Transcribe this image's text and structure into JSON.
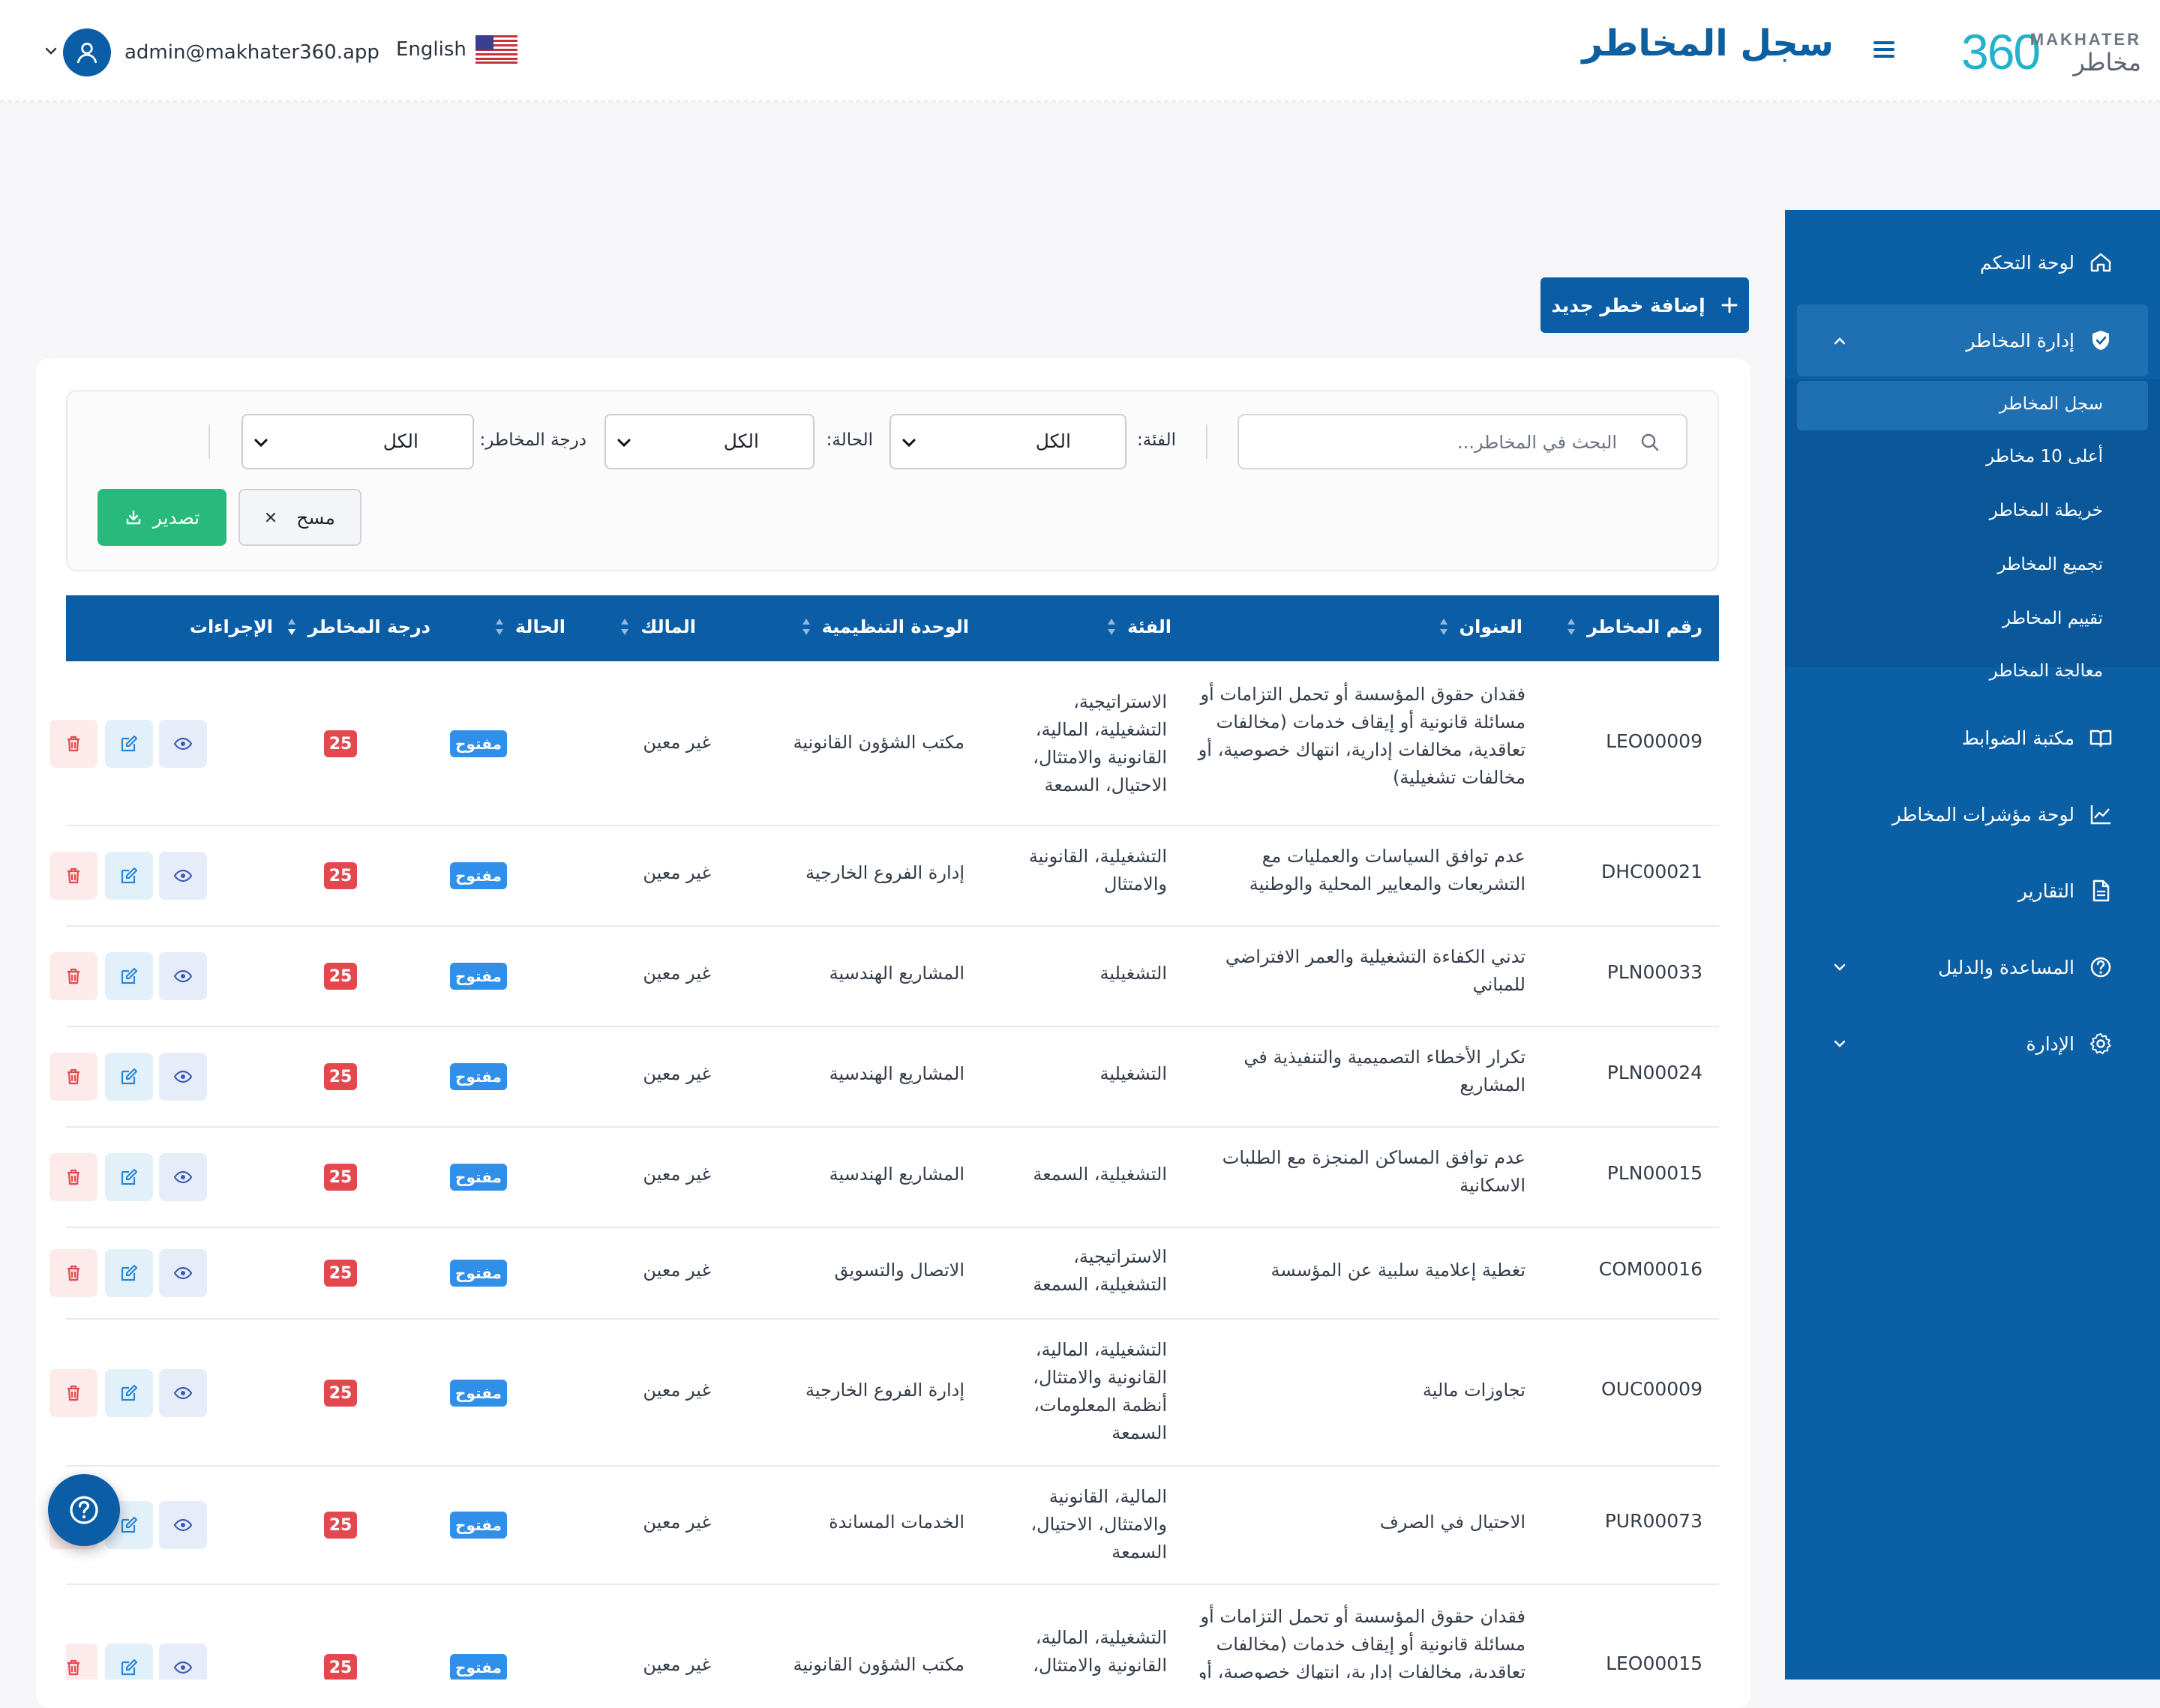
{
  "header": {
    "logo_num": "360",
    "logo_en": "MAKHATER",
    "logo_ar": "مخاطر",
    "title": "سجل المخاطر",
    "language": "English",
    "user_email": "admin@makhater360.app"
  },
  "sidebar": {
    "items": [
      {
        "label": "لوحة التحكم",
        "icon": "home-icon"
      },
      {
        "label": "إدارة المخاطر",
        "icon": "shield-icon"
      },
      {
        "label": "مكتبة الضوابط",
        "icon": "book-icon"
      },
      {
        "label": "لوحة مؤشرات المخاطر",
        "icon": "chart-line-icon"
      },
      {
        "label": "التقارير",
        "icon": "document-icon"
      },
      {
        "label": "المساعدة والدليل",
        "icon": "help-circle-icon"
      },
      {
        "label": "الإدارة",
        "icon": "gear-icon"
      }
    ],
    "submenu": [
      {
        "label": "سجل المخاطر"
      },
      {
        "label": "أعلى 10 مخاطر"
      },
      {
        "label": "خريطة المخاطر"
      },
      {
        "label": "تجميع المخاطر"
      },
      {
        "label": "تقييم المخاطر"
      },
      {
        "label": "معالجة المخاطر"
      }
    ]
  },
  "toolbar": {
    "add_label": "إضافة خطر جديد"
  },
  "filters": {
    "search_placeholder": "البحث في المخاطر...",
    "category_label": "الفئة:",
    "category_value": "الكل",
    "status_label": "الحالة:",
    "status_value": "الكل",
    "level_label": "درجة المخاطر:",
    "level_value": "الكل",
    "clear_label": "مسح",
    "export_label": "تصدير"
  },
  "table": {
    "columns": [
      "رقم المخاطر",
      "العنوان",
      "الفئة",
      "الوحدة التنظيمية",
      "المالك",
      "الحالة",
      "درجة المخاطر",
      "الإجراءات"
    ],
    "rows": [
      {
        "id": "LEO00009",
        "title": "فقدان حقوق المؤسسة أو تحمل التزامات أو مسائلة قانونية أو إيقاف خدمات (مخالفات تعاقدية، مخالفات إدارية، انتهاك خصوصية، أو مخالفات تشغيلية)",
        "category": "الاستراتيجية، التشغيلية، المالية، القانونية والامتثال، الاحتيال، السمعة",
        "unit": "مكتب الشؤون القانونية",
        "owner": "غير معين",
        "status": "مفتوح",
        "score": "25"
      },
      {
        "id": "DHC00021",
        "title": "عدم توافق السياسات والعمليات مع التشريعات والمعايير المحلية والوطنية",
        "category": "التشغيلية، القانونية والامتثال",
        "unit": "إدارة الفروع الخارجية",
        "owner": "غير معين",
        "status": "مفتوح",
        "score": "25"
      },
      {
        "id": "PLN00033",
        "title": "تدني الكفاءة التشغيلية والعمر الافتراضي للمباني",
        "category": "التشغيلية",
        "unit": "المشاريع الهندسية",
        "owner": "غير معين",
        "status": "مفتوح",
        "score": "25"
      },
      {
        "id": "PLN00024",
        "title": "تكرار الأخطاء التصميمية والتنفيذية في المشاريع",
        "category": "التشغيلية",
        "unit": "المشاريع الهندسية",
        "owner": "غير معين",
        "status": "مفتوح",
        "score": "25"
      },
      {
        "id": "PLN00015",
        "title": "عدم توافق المساكن المنجزة مع الطلبات الاسكانية",
        "category": "التشغيلية، السمعة",
        "unit": "المشاريع الهندسية",
        "owner": "غير معين",
        "status": "مفتوح",
        "score": "25"
      },
      {
        "id": "COM00016",
        "title": "تغطية إعلامية سلبية عن المؤسسة",
        "category": "الاستراتيجية، التشغيلية، السمعة",
        "unit": "الاتصال والتسويق",
        "owner": "غير معين",
        "status": "مفتوح",
        "score": "25"
      },
      {
        "id": "OUC00009",
        "title": "تجاوزات مالية",
        "category": "التشغيلية، المالية، القانونية والامتثال، أنظمة المعلومات، السمعة",
        "unit": "إدارة الفروع الخارجية",
        "owner": "غير معين",
        "status": "مفتوح",
        "score": "25"
      },
      {
        "id": "PUR00073",
        "title": "الاحتيال في الصرف",
        "category": "المالية، القانونية والامتثال، الاحتيال، السمعة",
        "unit": "الخدمات المساندة",
        "owner": "غير معين",
        "status": "مفتوح",
        "score": "25"
      },
      {
        "id": "LEO00015",
        "title": "فقدان حقوق المؤسسة أو تحمل التزامات أو مسائلة قانونية أو إيقاف خدمات (مخالفات تعاقدية، مخالفات إدارية، انتهاك خصوصية، أو مخالفات تشغيلية)",
        "category": "التشغيلية، المالية، القانونية والامتثال، الاحتيال",
        "unit": "مكتب الشؤون القانونية",
        "owner": "غير معين",
        "status": "مفتوح",
        "score": "25"
      }
    ]
  },
  "colors": {
    "primary": "#0b5ea6",
    "sidebar": "#0b5fa4",
    "export": "#27ba7c",
    "status_open": "#2f8fe9",
    "score_high": "#e4484f"
  }
}
